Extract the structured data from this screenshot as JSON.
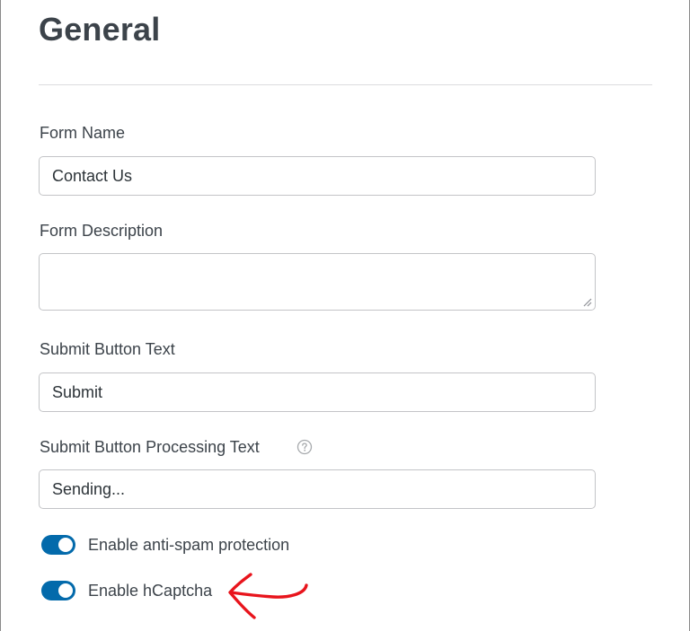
{
  "section": {
    "title": "General"
  },
  "form_name": {
    "label": "Form Name",
    "value": "Contact Us"
  },
  "form_description": {
    "label": "Form Description",
    "value": ""
  },
  "submit_text": {
    "label": "Submit Button Text",
    "value": "Submit"
  },
  "processing_text": {
    "label": "Submit Button Processing Text",
    "value": "Sending...",
    "help_icon": "question-circle-icon"
  },
  "toggles": [
    {
      "label": "Enable anti-spam protection",
      "enabled": true
    },
    {
      "label": "Enable hCaptcha",
      "enabled": true
    }
  ],
  "annotation": {
    "arrow_icon": "hand-drawn-arrow-icon",
    "arrow_color": "#e8141c"
  },
  "colors": {
    "toggle_on": "#036aab",
    "text": "#3c434a",
    "border": "#c3c4c7"
  }
}
